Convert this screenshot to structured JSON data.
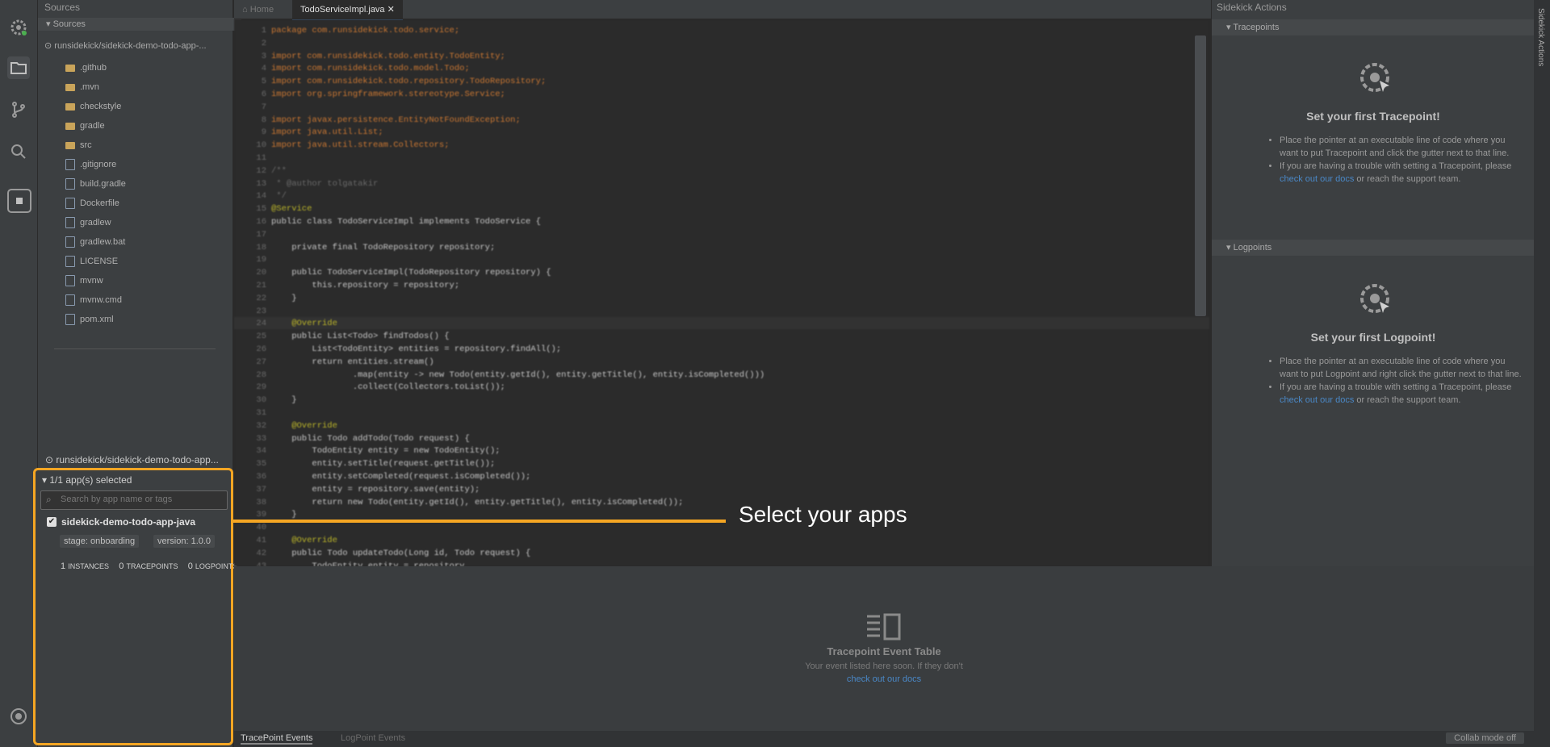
{
  "sidebar": {
    "header": "Sources",
    "section": "Sources",
    "repo": "runsidekick/sidekick-demo-todo-app-...",
    "items": [
      {
        "name": ".github",
        "type": "folder"
      },
      {
        "name": ".mvn",
        "type": "folder"
      },
      {
        "name": "checkstyle",
        "type": "folder"
      },
      {
        "name": "gradle",
        "type": "folder"
      },
      {
        "name": "src",
        "type": "folder"
      },
      {
        "name": ".gitignore",
        "type": "file"
      },
      {
        "name": "build.gradle",
        "type": "file"
      },
      {
        "name": "Dockerfile",
        "type": "file"
      },
      {
        "name": "gradlew",
        "type": "file"
      },
      {
        "name": "gradlew.bat",
        "type": "file"
      },
      {
        "name": "LICENSE",
        "type": "file"
      },
      {
        "name": "mvnw",
        "type": "file"
      },
      {
        "name": "mvnw.cmd",
        "type": "file"
      },
      {
        "name": "pom.xml",
        "type": "file"
      }
    ]
  },
  "apps_panel": {
    "repo": "runsidekick/sidekick-demo-todo-app...",
    "selected_label": "1/1 app(s) selected",
    "search_placeholder": "Search by app name or tags",
    "app_name": "sidekick-demo-todo-app-java",
    "tag_stage": "stage: onboarding",
    "tag_version": "version: 1.0.0",
    "instances_count": "1",
    "instances_label": "INSTANCES",
    "tracepoints_count": "0",
    "tracepoints_label": "TRACEPOINTS",
    "logpoints_count": "0",
    "logpoints_label": "LOGPOINTS"
  },
  "editor": {
    "tabs": [
      {
        "label": "Home",
        "active": false
      },
      {
        "label": "TodoServiceImpl.java",
        "active": true
      }
    ],
    "lines": [
      "package com.runsidekick.todo.service;",
      "",
      "import com.runsidekick.todo.entity.TodoEntity;",
      "import com.runsidekick.todo.model.Todo;",
      "import com.runsidekick.todo.repository.TodoRepository;",
      "import org.springframework.stereotype.Service;",
      "",
      "import javax.persistence.EntityNotFoundException;",
      "import java.util.List;",
      "import java.util.stream.Collectors;",
      "",
      "/**",
      " * @author tolgatakir",
      " */",
      "@Service",
      "public class TodoServiceImpl implements TodoService {",
      "",
      "    private final TodoRepository repository;",
      "",
      "    public TodoServiceImpl(TodoRepository repository) {",
      "        this.repository = repository;",
      "    }",
      "",
      "    @Override",
      "    public List<Todo> findTodos() {",
      "        List<TodoEntity> entities = repository.findAll();",
      "        return entities.stream()",
      "                .map(entity -> new Todo(entity.getId(), entity.getTitle(), entity.isCompleted()))",
      "                .collect(Collectors.toList());",
      "    }",
      "",
      "    @Override",
      "    public Todo addTodo(Todo request) {",
      "        TodoEntity entity = new TodoEntity();",
      "        entity.setTitle(request.getTitle());",
      "        entity.setCompleted(request.isCompleted());",
      "        entity = repository.save(entity);",
      "        return new Todo(entity.getId(), entity.getTitle(), entity.isCompleted());",
      "    }",
      "",
      "    @Override",
      "    public Todo updateTodo(Long id, Todo request) {",
      "        TodoEntity entity = repository..."
    ]
  },
  "right_panel": {
    "header": "Sidekick Actions",
    "tracepoints": {
      "section": "Tracepoints",
      "title": "Set your first Tracepoint!",
      "bullet1": "Place the pointer at an executable line of code where you want to put Tracepoint and click the gutter next to that line.",
      "bullet2_pre": "If you are having a trouble with setting a Tracepoint, please",
      "bullet2_link": "check out our docs",
      "bullet2_post": "or reach the support team."
    },
    "logpoints": {
      "section": "Logpoints",
      "title": "Set your first Logpoint!",
      "bullet1": "Place the pointer at an executable line of code where you want to put Logpoint and right click the gutter next to that line.",
      "bullet2_pre": "If you are having a trouble with setting a Tracepoint, please",
      "bullet2_link": "check out our docs",
      "bullet2_post": "or reach the support team."
    },
    "vertical_tab": "Sidekick Actions"
  },
  "bottom_panel": {
    "title": "Tracepoint Event Table",
    "subtitle": "Your event listed here soon. If they don't",
    "link": "check out our docs",
    "tabs": [
      "TracePoint Events",
      "LogPoint Events"
    ],
    "collab_button": "Collab mode off"
  },
  "callout": {
    "text": "Select your apps"
  },
  "colors": {
    "accent": "#f5a623",
    "link": "#4a88c7",
    "background": "#2b2b2b"
  }
}
